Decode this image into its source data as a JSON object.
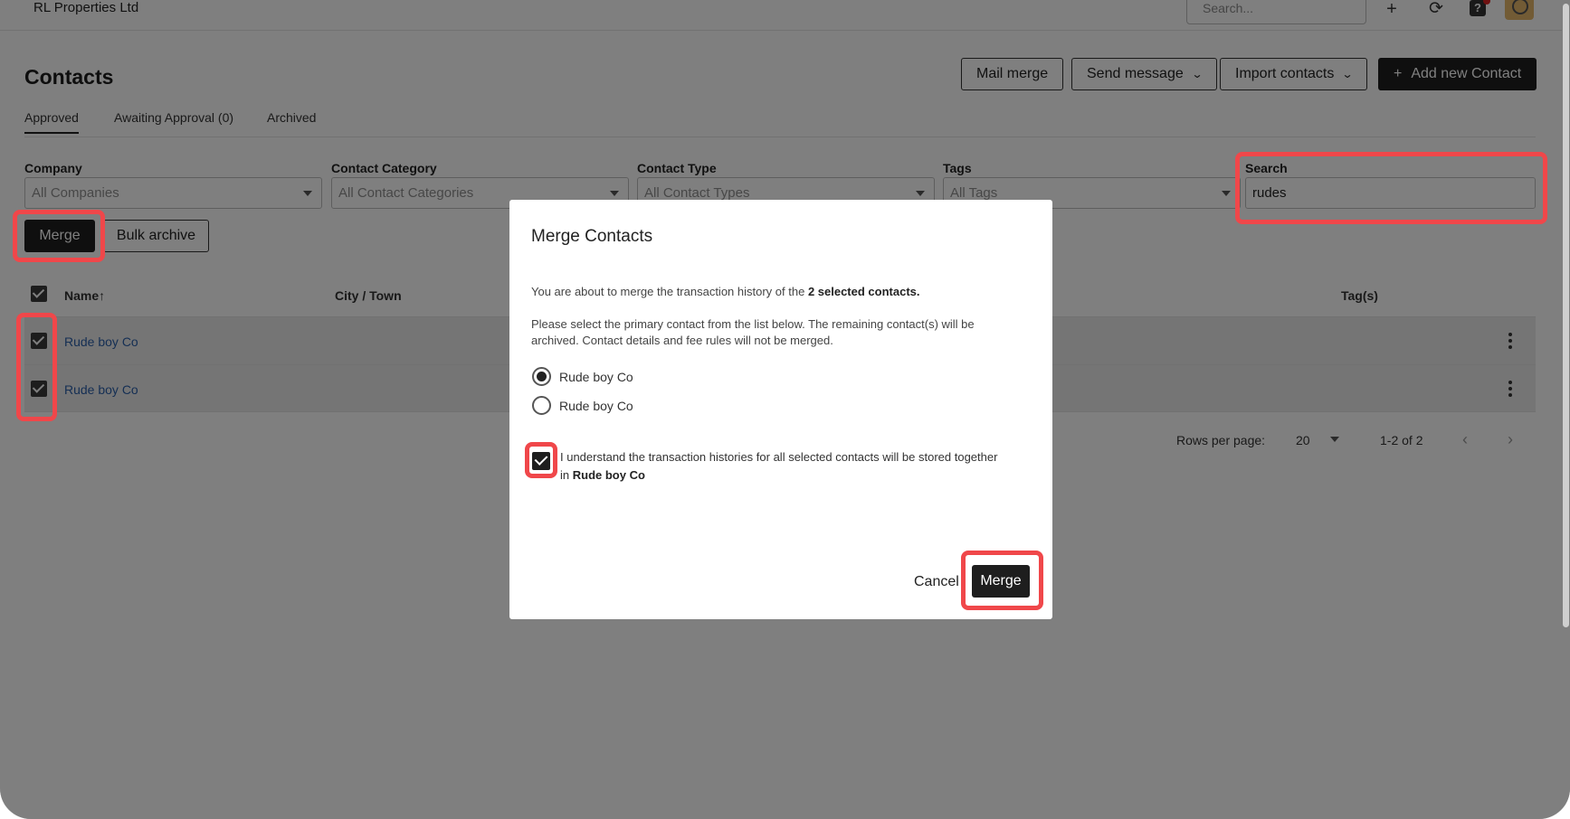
{
  "app": {
    "org_name": "RL Properties Ltd",
    "top_search_placeholder": "Search...",
    "icons": [
      "plus-icon",
      "refresh-icon",
      "help-icon",
      "avatar"
    ]
  },
  "header": {
    "title": "Contacts",
    "buttons": {
      "mail_merge": "Mail merge",
      "send_message": "Send message",
      "import_contacts": "Import contacts",
      "add_new_contact": "Add new Contact"
    }
  },
  "tabs": [
    {
      "label": "Approved",
      "active": true
    },
    {
      "label": "Awaiting Approval (0)",
      "active": false
    },
    {
      "label": "Archived",
      "active": false
    }
  ],
  "filters": {
    "company": {
      "label": "Company",
      "value": "All Companies"
    },
    "category": {
      "label": "Contact Category",
      "value": "All Contact Categories"
    },
    "type": {
      "label": "Contact Type",
      "value": "All Contact Types"
    },
    "tags": {
      "label": "Tags",
      "value": "All Tags"
    },
    "search": {
      "label": "Search",
      "value": "rudes"
    }
  },
  "actions": {
    "merge": "Merge",
    "bulk_archive": "Bulk archive"
  },
  "table": {
    "columns": [
      "Name",
      "City / Town",
      "Tag(s)"
    ],
    "sort_indicator": "↑",
    "rows": [
      {
        "name": "Rude boy Co",
        "checked": true
      },
      {
        "name": "Rude boy Co",
        "checked": true
      }
    ]
  },
  "pagination": {
    "rows_per_page_label": "Rows per page:",
    "rows_per_page": "20",
    "range": "1-2 of 2"
  },
  "modal": {
    "title": "Merge Contacts",
    "intro_prefix": "You are about to merge the transaction history of the ",
    "intro_bold": "2 selected contacts.",
    "instructions": "Please select the primary contact from the list below. The remaining contact(s) will be archived. Contact details and fee rules will not be merged.",
    "options": [
      {
        "label": "Rude boy Co",
        "selected": true
      },
      {
        "label": "Rude boy Co",
        "selected": false
      }
    ],
    "ack_prefix": "I understand the transaction histories for all selected contacts will be stored together in ",
    "ack_bold": "Rude boy Co",
    "ack_checked": true,
    "cancel": "Cancel",
    "confirm": "Merge"
  },
  "colors": {
    "highlight": "#f0474a",
    "primary_button": "#1e1e1e",
    "link": "#2a5ea8"
  }
}
